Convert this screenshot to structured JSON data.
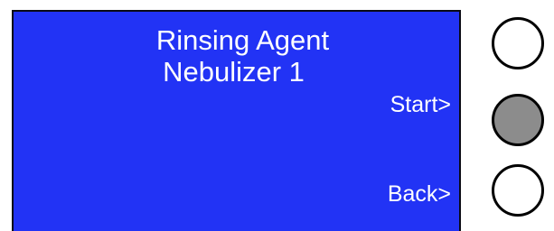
{
  "screen": {
    "title_line1": "Rinsing Agent",
    "title_line2": "Nebulizer 1",
    "softkey_start_label": "Start>",
    "softkey_back_label": "Back>"
  },
  "hardware_buttons": [
    {
      "name": "top",
      "state": "idle"
    },
    {
      "name": "start",
      "state": "pressed"
    },
    {
      "name": "back",
      "state": "idle"
    }
  ],
  "colors": {
    "screen_background": "#2233f5",
    "screen_text": "#ffffff",
    "button_idle_fill": "#ffffff",
    "button_pressed_fill": "#8c8c8c",
    "button_outline": "#000000"
  }
}
